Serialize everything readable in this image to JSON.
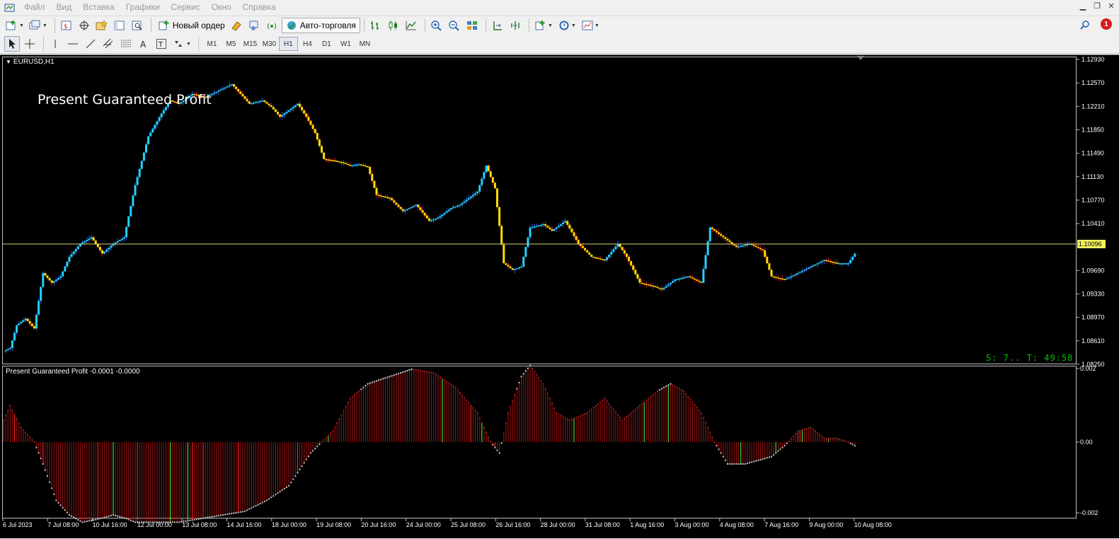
{
  "menu": {
    "items": [
      "Файл",
      "Вид",
      "Вставка",
      "Графики",
      "Сервис",
      "Окно",
      "Справка"
    ]
  },
  "window_controls": [
    "minimize-icon",
    "restore-icon",
    "close-icon"
  ],
  "toolbar": {
    "new_order_label": "Новый ордер",
    "autotrade_label": "Авто-торговля",
    "notification_count": "1"
  },
  "timeframes": [
    "M1",
    "M5",
    "M15",
    "M30",
    "H1",
    "H4",
    "D1",
    "W1",
    "MN"
  ],
  "active_timeframe": "H1",
  "chart": {
    "symbol_label": "EURUSD,H1",
    "overlay_title": "Present Guaranteed Profit",
    "status_text": "S: 7.. T: 49:58",
    "indicator_label": "Present Guaranteed Profit -0.0001 -0.0000",
    "current_price": "1.10096",
    "price_ticks": [
      "1.12930",
      "1.12570",
      "1.12210",
      "1.11850",
      "1.11490",
      "1.11130",
      "1.10770",
      "1.10410",
      "1.09690",
      "1.09330",
      "1.08970",
      "1.08610",
      "1.08250"
    ],
    "indicator_ticks": [
      "0.002",
      "0.00",
      "-0.002"
    ],
    "time_ticks": [
      "6 Jul 2023",
      "7 Jul 08:00",
      "10 Jul 16:00",
      "12 Jul 00:00",
      "13 Jul 08:00",
      "14 Jul 16:00",
      "18 Jul 00:00",
      "19 Jul 08:00",
      "20 Jul 16:00",
      "24 Jul 00:00",
      "25 Jul 08:00",
      "26 Jul 16:00",
      "28 Jul 00:00",
      "31 Jul 08:00",
      "1 Aug 16:00",
      "3 Aug 00:00",
      "4 Aug 08:00",
      "7 Aug 16:00",
      "9 Aug 00:00",
      "10 Aug 08:00"
    ]
  },
  "colors": {
    "up": "#22d3ff",
    "down": "#ffe100",
    "price_line": "#d8d870",
    "hist_base": "#8a1010",
    "hist_green": "#40e040",
    "hist_red": "#ff2020",
    "hist_white": "#d0d0d0"
  },
  "chart_data": {
    "type": "line",
    "ylim": [
      1.0825,
      1.1293
    ],
    "price_path_anchors": [
      [
        0,
        1.0845
      ],
      [
        3,
        1.085
      ],
      [
        6,
        1.0885
      ],
      [
        10,
        1.0895
      ],
      [
        14,
        1.088
      ],
      [
        18,
        1.0965
      ],
      [
        22,
        1.095
      ],
      [
        26,
        1.096
      ],
      [
        30,
        1.099
      ],
      [
        35,
        1.101
      ],
      [
        40,
        1.102
      ],
      [
        45,
        1.0995
      ],
      [
        50,
        1.101
      ],
      [
        55,
        1.102
      ],
      [
        60,
        1.11
      ],
      [
        66,
        1.1175
      ],
      [
        72,
        1.121
      ],
      [
        76,
        1.123
      ],
      [
        80,
        1.1225
      ],
      [
        86,
        1.124
      ],
      [
        92,
        1.1235
      ],
      [
        98,
        1.1245
      ],
      [
        104,
        1.1255
      ],
      [
        108,
        1.124
      ],
      [
        112,
        1.1225
      ],
      [
        118,
        1.123
      ],
      [
        122,
        1.122
      ],
      [
        126,
        1.1205
      ],
      [
        130,
        1.1215
      ],
      [
        134,
        1.1225
      ],
      [
        138,
        1.1205
      ],
      [
        142,
        1.118
      ],
      [
        146,
        1.114
      ],
      [
        150,
        1.1138
      ],
      [
        154,
        1.1135
      ],
      [
        158,
        1.113
      ],
      [
        162,
        1.1132
      ],
      [
        166,
        1.1128
      ],
      [
        170,
        1.1085
      ],
      [
        176,
        1.108
      ],
      [
        182,
        1.106
      ],
      [
        188,
        1.107
      ],
      [
        194,
        1.1045
      ],
      [
        198,
        1.105
      ],
      [
        204,
        1.1065
      ],
      [
        208,
        1.107
      ],
      [
        212,
        1.108
      ],
      [
        216,
        1.109
      ],
      [
        220,
        1.113
      ],
      [
        224,
        1.1095
      ],
      [
        228,
        1.098
      ],
      [
        232,
        1.097
      ],
      [
        236,
        1.0975
      ],
      [
        240,
        1.1035
      ],
      [
        246,
        1.104
      ],
      [
        250,
        1.103
      ],
      [
        256,
        1.1045
      ],
      [
        262,
        1.101
      ],
      [
        268,
        1.099
      ],
      [
        274,
        1.0985
      ],
      [
        280,
        1.101
      ],
      [
        284,
        1.099
      ],
      [
        290,
        1.095
      ],
      [
        296,
        1.0945
      ],
      [
        300,
        1.094
      ],
      [
        306,
        1.0955
      ],
      [
        312,
        1.096
      ],
      [
        318,
        1.095
      ],
      [
        322,
        1.1035
      ],
      [
        328,
        1.102
      ],
      [
        334,
        1.1005
      ],
      [
        340,
        1.101
      ],
      [
        346,
        1.1
      ],
      [
        350,
        1.096
      ],
      [
        356,
        1.0955
      ],
      [
        362,
        1.0965
      ],
      [
        368,
        1.0975
      ],
      [
        374,
        1.0985
      ],
      [
        380,
        1.098
      ],
      [
        385,
        1.098
      ],
      [
        388,
        1.0995
      ]
    ],
    "indicator_anchors": [
      [
        0,
        0.0006
      ],
      [
        3,
        0.001
      ],
      [
        8,
        0.0004
      ],
      [
        14,
        0.0
      ],
      [
        18,
        -0.0006
      ],
      [
        24,
        -0.0016
      ],
      [
        30,
        -0.002
      ],
      [
        36,
        -0.0022
      ],
      [
        44,
        -0.0021
      ],
      [
        50,
        -0.002
      ],
      [
        56,
        -0.0021
      ],
      [
        60,
        -0.0022
      ],
      [
        70,
        -0.0022
      ],
      [
        80,
        -0.0022
      ],
      [
        90,
        -0.0021
      ],
      [
        100,
        -0.002
      ],
      [
        110,
        -0.0019
      ],
      [
        120,
        -0.0016
      ],
      [
        130,
        -0.0012
      ],
      [
        140,
        -0.0003
      ],
      [
        145,
        0.0
      ],
      [
        150,
        0.0003
      ],
      [
        158,
        0.0012
      ],
      [
        166,
        0.0016
      ],
      [
        176,
        0.0018
      ],
      [
        186,
        0.002
      ],
      [
        196,
        0.0019
      ],
      [
        206,
        0.0015
      ],
      [
        216,
        0.0008
      ],
      [
        222,
        0.0
      ],
      [
        226,
        -0.0003
      ],
      [
        230,
        0.0008
      ],
      [
        236,
        0.0018
      ],
      [
        240,
        0.0021
      ],
      [
        246,
        0.0016
      ],
      [
        252,
        0.0008
      ],
      [
        258,
        0.0006
      ],
      [
        266,
        0.0008
      ],
      [
        274,
        0.0012
      ],
      [
        282,
        0.0006
      ],
      [
        290,
        0.001
      ],
      [
        298,
        0.0014
      ],
      [
        304,
        0.0016
      ],
      [
        310,
        0.0014
      ],
      [
        318,
        0.0008
      ],
      [
        324,
        0.0
      ],
      [
        330,
        -0.0006
      ],
      [
        338,
        -0.0006
      ],
      [
        344,
        -0.0005
      ],
      [
        350,
        -0.0004
      ],
      [
        356,
        -0.0001
      ],
      [
        362,
        0.0003
      ],
      [
        368,
        0.0004
      ],
      [
        374,
        0.0001
      ],
      [
        380,
        0.0001
      ],
      [
        385,
        0.0
      ],
      [
        388,
        -0.0001
      ]
    ]
  }
}
